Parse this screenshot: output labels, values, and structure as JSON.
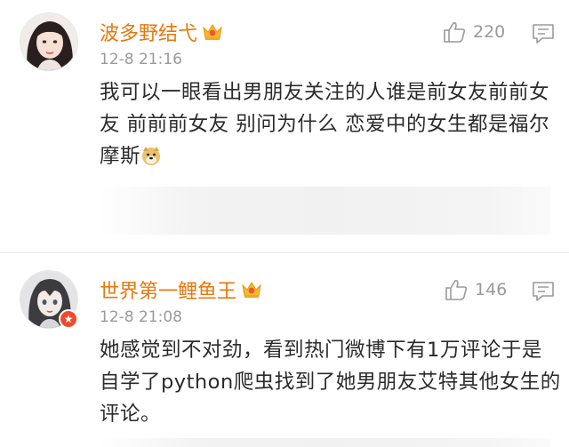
{
  "comments": [
    {
      "username": "波多野结弋",
      "time": "12-8 21:16",
      "likes": "220",
      "text": "我可以一眼看出男朋友关注的人谁是前女友前前女友 前前前女友 别问为什么 恋爱中的女生都是福尔摩斯",
      "avatar_icon": "avatar-girl",
      "crown_icon": "crown-icon",
      "emoji": "doge-emoji"
    },
    {
      "username": "世界第一鲤鱼王",
      "time": "12-8 21:08",
      "likes": "146",
      "text": "她感觉到不对劲，看到热门微博下有1万评论于是自学了python爬虫找到了她男朋友艾特其他女生的评论。",
      "avatar_icon": "avatar-anime",
      "crown_icon": "crown-icon"
    }
  ],
  "colors": {
    "username": "#e8780c",
    "meta": "#9a9a9a",
    "body_text": "#2b2b2b",
    "vip_badge": "#f04a2e"
  }
}
